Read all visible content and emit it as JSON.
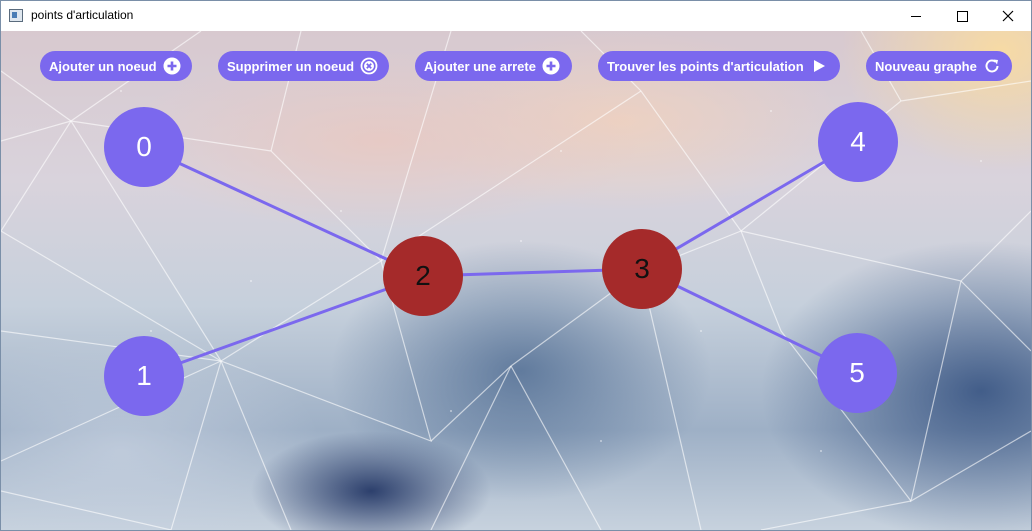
{
  "window": {
    "title": "points d'articulation",
    "controls": [
      "minimize",
      "maximize",
      "close"
    ]
  },
  "toolbar": {
    "add_node": "Ajouter un noeud",
    "remove_node": "Supprimer un noeud",
    "add_edge": "Ajouter une arrete",
    "find_articulation": "Trouver les points d'articulation",
    "new_graph": "Nouveau graphe"
  },
  "graph": {
    "nodes": [
      {
        "id": "0",
        "label": "0",
        "articulation": false
      },
      {
        "id": "1",
        "label": "1",
        "articulation": false
      },
      {
        "id": "2",
        "label": "2",
        "articulation": true
      },
      {
        "id": "3",
        "label": "3",
        "articulation": true
      },
      {
        "id": "4",
        "label": "4",
        "articulation": false
      },
      {
        "id": "5",
        "label": "5",
        "articulation": false
      }
    ],
    "edges": [
      [
        "0",
        "2"
      ],
      [
        "1",
        "2"
      ],
      [
        "2",
        "3"
      ],
      [
        "3",
        "4"
      ],
      [
        "3",
        "5"
      ]
    ]
  },
  "colors": {
    "node": "#7b68ee",
    "articulation_node": "#a52a2a",
    "edge": "#7b68ee",
    "button": "#7b68ee"
  }
}
